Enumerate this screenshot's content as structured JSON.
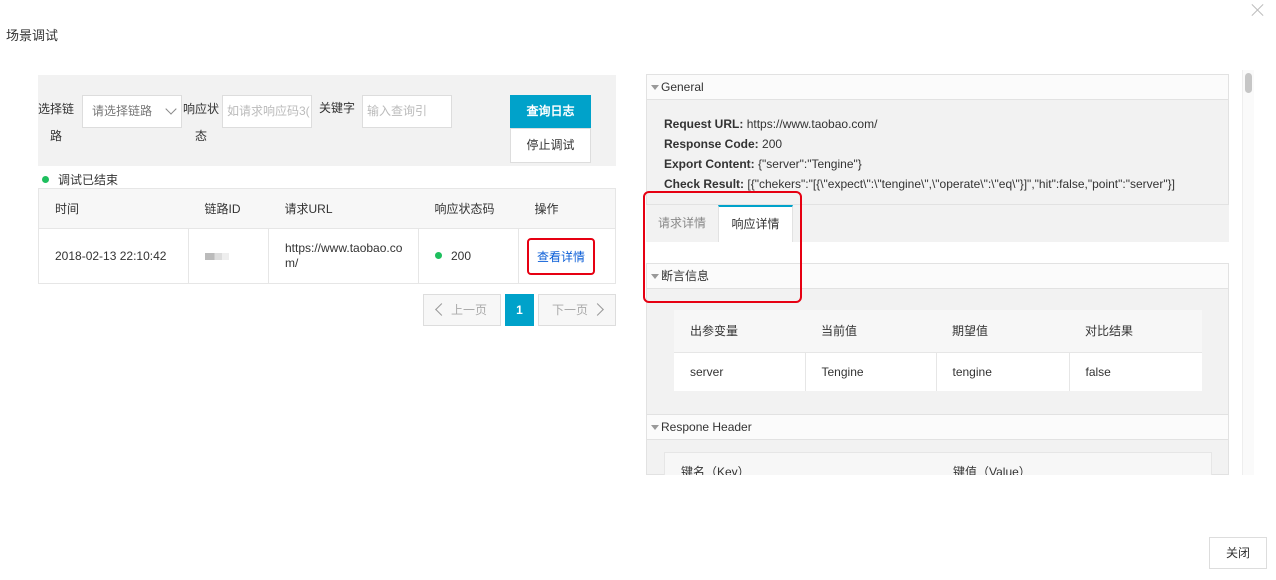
{
  "dialog": {
    "title": "场景调试",
    "close_label": "关闭"
  },
  "filters": {
    "chain_label_1": "选择链",
    "chain_label_2": "路",
    "chain_placeholder": "请选择链路",
    "status_label_1": "响应状",
    "status_label_2": "态",
    "status_placeholder": "如请求响应码3(",
    "keyword_label": "关键字",
    "keyword_placeholder": "输入查询引",
    "query_button": "查询日志",
    "stop_button": "停止调试"
  },
  "debug_status": {
    "text": "调试已结束",
    "color": "#1ebf5e"
  },
  "results": {
    "columns": [
      "时间",
      "链路ID",
      "请求URL",
      "响应状态码",
      "操作"
    ],
    "rows": [
      {
        "time": "2018-02-13 22:10:42",
        "chain_id": "",
        "url": "https://www.taobao.com/",
        "status_code": "200",
        "action": "查看详情"
      }
    ]
  },
  "pagination": {
    "prev": "上一页",
    "current": "1",
    "next": "下一页"
  },
  "general": {
    "title": "General",
    "lines": [
      {
        "key": "Request URL:",
        "value": "https://www.taobao.com/"
      },
      {
        "key": "Response Code:",
        "value": "200"
      },
      {
        "key": "Export Content:",
        "value": "{\"server\":\"Tengine\"}"
      },
      {
        "key": "Check Result:",
        "value": "[{\"chekers\":\"[{\\\"expect\\\":\\\"tengine\\\",\\\"operate\\\":\\\"eq\\\"}]\",\"hit\":false,\"point\":\"server\"}]"
      }
    ]
  },
  "detail_tabs": [
    {
      "label": "请求详情",
      "active": false
    },
    {
      "label": "响应详情",
      "active": true
    }
  ],
  "assertion": {
    "title": "断言信息",
    "columns": [
      "出参变量",
      "当前值",
      "期望值",
      "对比结果"
    ],
    "rows": [
      {
        "variable": "server",
        "current": "Tengine",
        "expected": "tengine",
        "result": "false"
      }
    ]
  },
  "response_header": {
    "title": "Respone Header",
    "columns": [
      "键名（Key）",
      "键值（Value）"
    ]
  },
  "colors": {
    "accent": "#00a2ca",
    "highlight": "#e60012"
  }
}
